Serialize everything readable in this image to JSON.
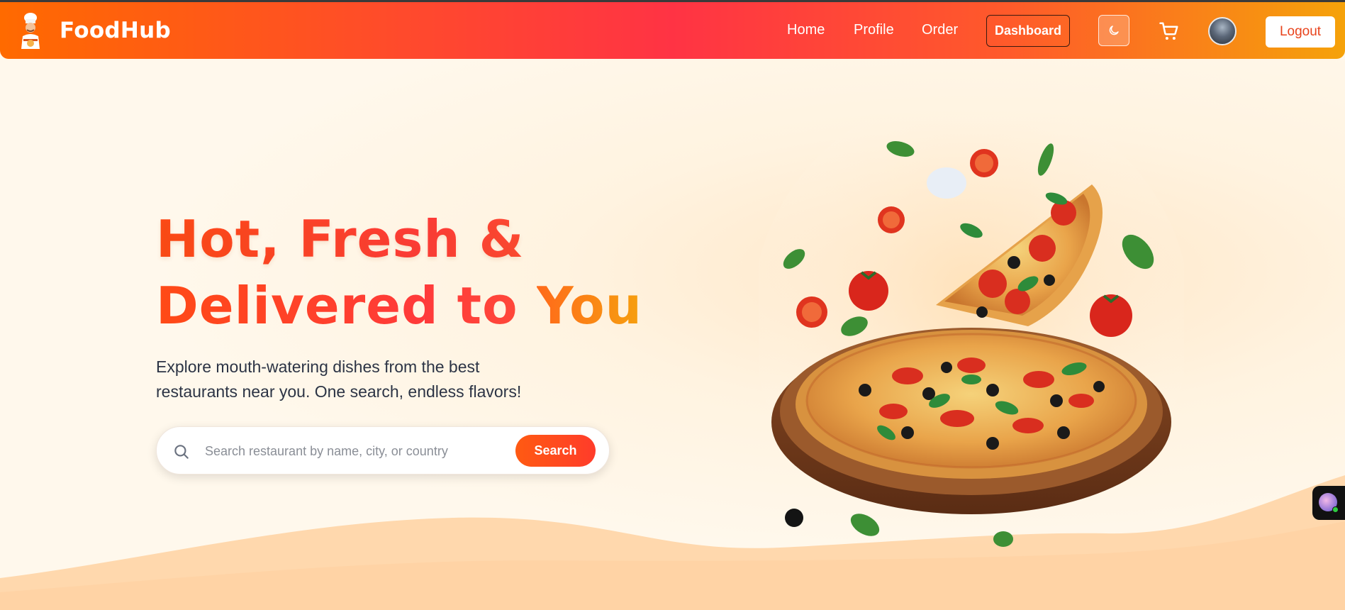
{
  "header": {
    "brand": "FoodHub",
    "nav": [
      {
        "label": "Home"
      },
      {
        "label": "Profile"
      },
      {
        "label": "Order"
      }
    ],
    "dashboard_label": "Dashboard",
    "logout_label": "Logout",
    "icons": {
      "logo": "chef-logo-icon",
      "theme": "moon-icon",
      "cart": "cart-icon",
      "avatar": "user-avatar"
    }
  },
  "hero": {
    "headline_line1": "Hot, Fresh &",
    "headline_line2a": "Delivered to ",
    "headline_line2b": "You",
    "subtext_line1": "Explore mouth-watering dishes from the best",
    "subtext_line2": "restaurants near you. One search, endless flavors!",
    "search": {
      "placeholder": "Search restaurant by name, city, or country",
      "value": "",
      "button_label": "Search",
      "icon": "search-icon"
    },
    "image": "pizza-illustration"
  },
  "colors": {
    "accent": "#ff4a16",
    "accent_secondary": "#f6a00f",
    "background": "#fff8ec",
    "wave": "#ffd6a8"
  },
  "floating_widget": {
    "icon": "assistant-widget-icon",
    "status": "online"
  }
}
